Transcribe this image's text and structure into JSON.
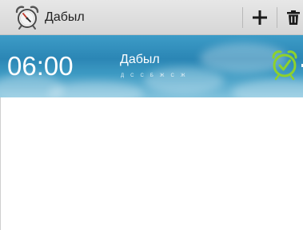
{
  "action_bar": {
    "title": "Дабыл",
    "app_icon": "alarm-clock-icon",
    "actions": [
      {
        "name": "add",
        "icon": "plus-icon"
      },
      {
        "name": "delete",
        "icon": "trash-icon"
      }
    ]
  },
  "alarm": {
    "time": "06:00",
    "name": "Дабыл",
    "days": "Д С С Б Ж С Ж",
    "toggle_icon": "alarm-on-icon",
    "colors": {
      "banner": "#2b86b5",
      "toggle_active": "#8ed12c"
    }
  }
}
